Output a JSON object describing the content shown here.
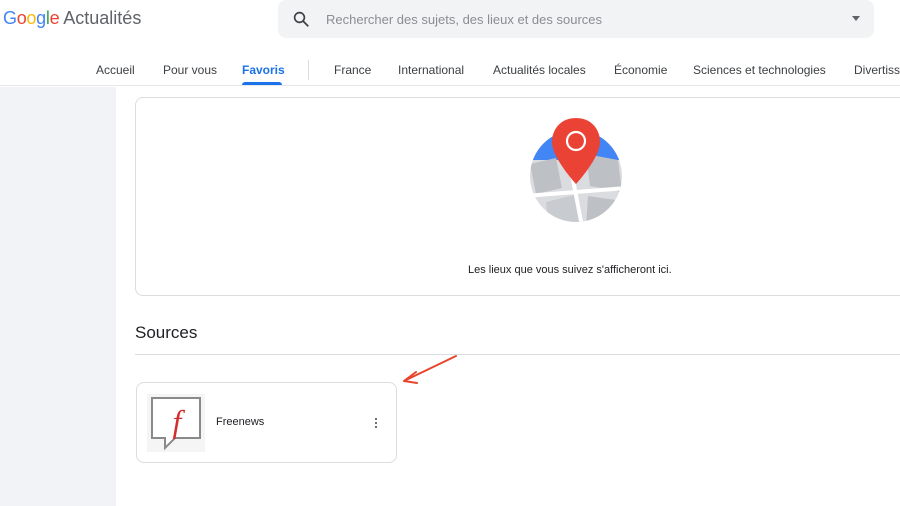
{
  "header": {
    "brand": [
      "G",
      "o",
      "o",
      "g",
      "l",
      "e"
    ],
    "product": "Actualités",
    "search": {
      "placeholder": "Rechercher des sujets, des lieux et des sources",
      "value": ""
    }
  },
  "tabs": [
    {
      "label": "Accueil",
      "active": false
    },
    {
      "label": "Pour vous",
      "active": false
    },
    {
      "label": "Favoris",
      "active": true
    },
    {
      "label": "France",
      "active": false
    },
    {
      "label": "International",
      "active": false
    },
    {
      "label": "Actualités locales",
      "active": false
    },
    {
      "label": "Économie",
      "active": false
    },
    {
      "label": "Sciences et technologies",
      "active": false
    },
    {
      "label": "Divertiss",
      "active": false
    }
  ],
  "places": {
    "empty_message": "Les lieux que vous suivez s'afficheront ici.",
    "icon": "map-pin-illustration"
  },
  "sources": {
    "title": "Sources",
    "items": [
      {
        "name": "Freenews",
        "logo_letter": "f",
        "menu_icon": "more-vert-icon"
      }
    ]
  },
  "colors": {
    "accent": "#1a73e8",
    "pin": "#ea4335",
    "freenews_red": "#d32f2f",
    "annotation_arrow": "#e8452c"
  }
}
